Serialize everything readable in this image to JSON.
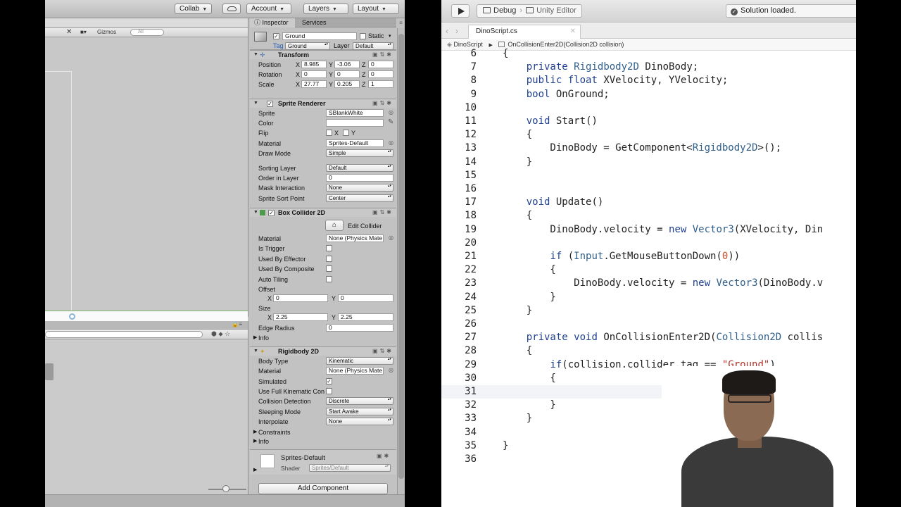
{
  "unity": {
    "toolbar": {
      "collab": "Collab",
      "account": "Account",
      "layers": "Layers",
      "layout": "Layout"
    },
    "scene": {
      "gizmos": "Gizmos",
      "search_placeholder": "All"
    },
    "inspector": {
      "tabs": [
        "Inspector",
        "Services"
      ],
      "object": {
        "name": "Ground",
        "static_label": "Static",
        "tag_label": "Tag",
        "tag_value": "Ground",
        "layer_label": "Layer",
        "layer_value": "Default"
      },
      "transform": {
        "title": "Transform",
        "position_label": "Position",
        "rotation_label": "Rotation",
        "scale_label": "Scale",
        "position": {
          "x": "8.985",
          "y": "-3.06",
          "z": "0"
        },
        "rotation": {
          "x": "0",
          "y": "0",
          "z": "0"
        },
        "scale": {
          "x": "27.77",
          "y": "0.205",
          "z": "1"
        }
      },
      "sprite_renderer": {
        "title": "Sprite Renderer",
        "sprite_label": "Sprite",
        "sprite_value": "SBlankWhite",
        "color_label": "Color",
        "flip_label": "Flip",
        "flip_x": "X",
        "flip_y": "Y",
        "material_label": "Material",
        "material_value": "Sprites-Default",
        "draw_mode_label": "Draw Mode",
        "draw_mode_value": "Simple",
        "sorting_layer_label": "Sorting Layer",
        "sorting_layer_value": "Default",
        "order_label": "Order in Layer",
        "order_value": "0",
        "mask_label": "Mask Interaction",
        "mask_value": "None",
        "sort_point_label": "Sprite Sort Point",
        "sort_point_value": "Center"
      },
      "box_collider": {
        "title": "Box Collider 2D",
        "edit_collider": "Edit Collider",
        "material_label": "Material",
        "material_value": "None (Physics Mate",
        "is_trigger": "Is Trigger",
        "used_by_effector": "Used By Effector",
        "used_by_composite": "Used By Composite",
        "auto_tiling": "Auto Tiling",
        "offset_label": "Offset",
        "offset": {
          "x": "0",
          "y": "0"
        },
        "size_label": "Size",
        "size": {
          "x": "2.25",
          "y": "2.25"
        },
        "edge_radius_label": "Edge Radius",
        "edge_radius_value": "0",
        "info": "Info"
      },
      "rigidbody": {
        "title": "Rigidbody 2D",
        "body_type_label": "Body Type",
        "body_type_value": "Kinematic",
        "material_label": "Material",
        "material_value": "None (Physics Mate",
        "simulated_label": "Simulated",
        "full_kinematic_label": "Use Full Kinematic Con",
        "collision_label": "Collision Detection",
        "collision_value": "Discrete",
        "sleeping_label": "Sleeping Mode",
        "sleeping_value": "Start Awake",
        "interpolate_label": "Interpolate",
        "interpolate_value": "None",
        "constraints": "Constraints",
        "info": "Info"
      },
      "material_footer": {
        "name": "Sprites-Default",
        "shader_label": "Shader",
        "shader_value": "Sprites/Default"
      },
      "add_component": "Add Component"
    }
  },
  "ide": {
    "toolbar": {
      "config": "Debug",
      "target": "Unity Editor",
      "status": "Solution loaded."
    },
    "tab": "DinoScript.cs",
    "breadcrumb": {
      "class": "DinoScript",
      "method": "OnCollisionEnter2D(Collision2D collision)"
    },
    "lines": [
      {
        "n": "6",
        "t": "{"
      },
      {
        "n": "7",
        "t": "    private Rigidbody2D DinoBody;"
      },
      {
        "n": "8",
        "t": "    public float XVelocity, YVelocity;"
      },
      {
        "n": "9",
        "t": "    bool OnGround;"
      },
      {
        "n": "10",
        "t": ""
      },
      {
        "n": "11",
        "t": "    void Start()"
      },
      {
        "n": "12",
        "t": "    {"
      },
      {
        "n": "13",
        "t": "        DinoBody = GetComponent<Rigidbody2D>();"
      },
      {
        "n": "14",
        "t": "    }"
      },
      {
        "n": "15",
        "t": ""
      },
      {
        "n": "16",
        "t": ""
      },
      {
        "n": "17",
        "t": "    void Update()"
      },
      {
        "n": "18",
        "t": "    {"
      },
      {
        "n": "19",
        "t": "        DinoBody.velocity = new Vector3(XVelocity, Din"
      },
      {
        "n": "20",
        "t": ""
      },
      {
        "n": "21",
        "t": "        if (Input.GetMouseButtonDown(0))"
      },
      {
        "n": "22",
        "t": "        {"
      },
      {
        "n": "23",
        "t": "            DinoBody.velocity = new Vector3(DinoBody.v"
      },
      {
        "n": "24",
        "t": "        }"
      },
      {
        "n": "25",
        "t": "    }"
      },
      {
        "n": "26",
        "t": ""
      },
      {
        "n": "27",
        "t": "    private void OnCollisionEnter2D(Collision2D collis"
      },
      {
        "n": "28",
        "t": "    {"
      },
      {
        "n": "29",
        "t": "        if(collision.collider.tag == \"Ground\")"
      },
      {
        "n": "30",
        "t": "        {"
      },
      {
        "n": "31",
        "t": ""
      },
      {
        "n": "32",
        "t": "        }"
      },
      {
        "n": "33",
        "t": "    }"
      },
      {
        "n": "34",
        "t": ""
      },
      {
        "n": "35",
        "t": "}"
      },
      {
        "n": "36",
        "t": ""
      }
    ]
  },
  "colors": {
    "keyword": "#1f3f8f",
    "type": "#2f5f8a",
    "string": "#b5342a",
    "number": "#c9502a"
  }
}
